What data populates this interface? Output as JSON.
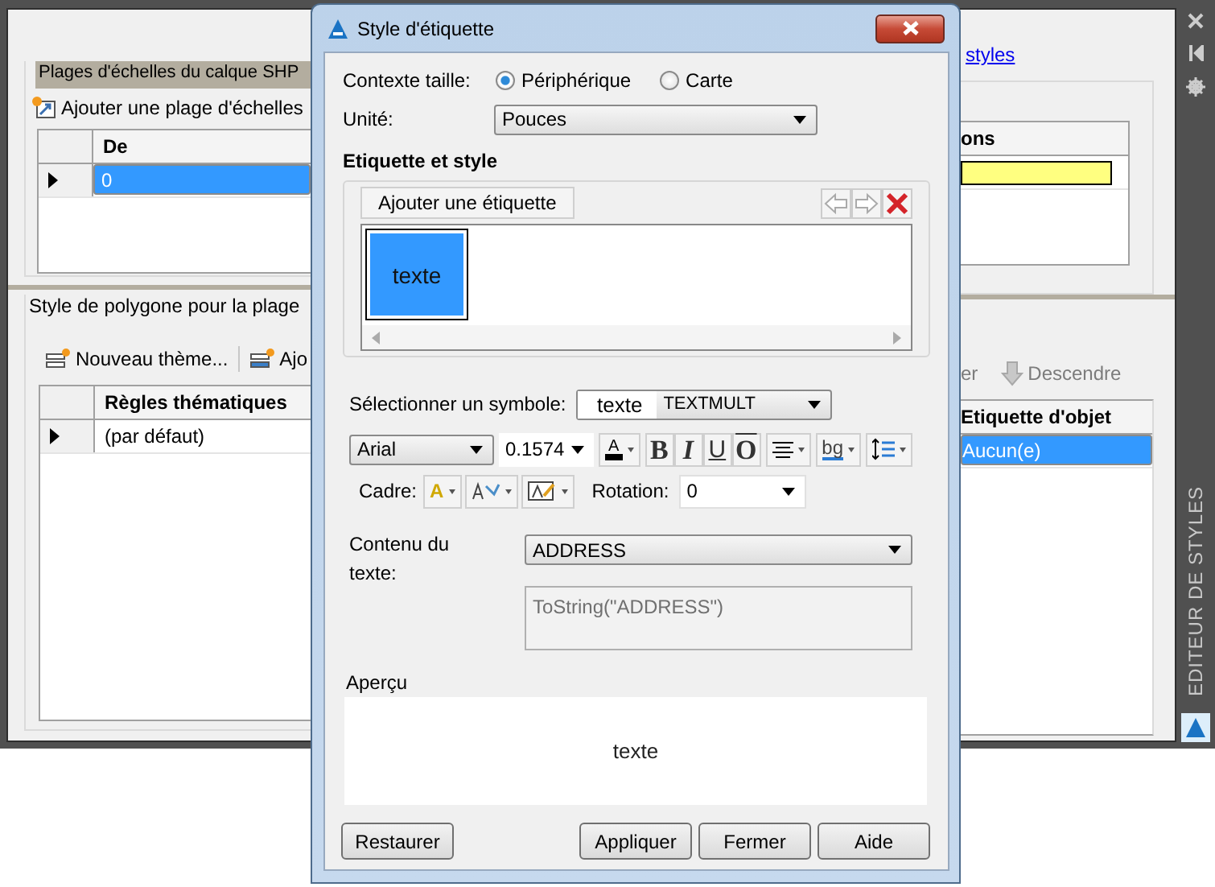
{
  "panel": {
    "scale_group": {
      "title": "Plages d'échelles du calque SHP",
      "add_button": "Ajouter une plage d'échelles",
      "left_column": "De",
      "rows": [
        {
          "value": "0",
          "selected": true
        }
      ]
    },
    "styles_link": "styles",
    "right_column": "ons",
    "right_rows": [
      {
        "color": "#ffff80"
      }
    ],
    "polygon_group": {
      "title": "Style de polygone pour la plage",
      "tools": [
        {
          "label": "Nouveau thème...",
          "disabled": false
        },
        {
          "label": "Ajo",
          "disabled": false
        }
      ],
      "right_tools": [
        {
          "label": "er",
          "disabled": true
        },
        {
          "label": "Descendre",
          "disabled": true
        }
      ],
      "left_column": "Règles thématiques",
      "right_column": "Etiquette d'objet",
      "rows": [
        {
          "rule": "(par défaut)",
          "label": "Aucun(e)",
          "selected": true
        }
      ]
    }
  },
  "side_strip": {
    "title": "EDITEUR DE STYLES"
  },
  "dialog": {
    "title": "Style d'étiquette",
    "size_context": {
      "label": "Contexte taille:",
      "options": [
        {
          "label": "Périphérique",
          "selected": true
        },
        {
          "label": "Carte",
          "selected": false
        }
      ]
    },
    "unit": {
      "label": "Unité:",
      "value": "Pouces"
    },
    "label_section": {
      "title": "Etiquette et style",
      "add_button": "Ajouter une étiquette",
      "labels": [
        {
          "text": "texte",
          "selected": true
        }
      ]
    },
    "symbol": {
      "label": "Sélectionner un symbole:",
      "preview": "texte",
      "value": "TEXTMULT"
    },
    "format": {
      "font": "Arial",
      "size": "0.1574",
      "color_button": "A",
      "style_buttons": [
        {
          "label": "B",
          "on": false
        },
        {
          "label": "I",
          "on": false
        },
        {
          "label": "U",
          "on": false
        },
        {
          "label": "O",
          "on": false
        }
      ],
      "bg_button": "bg"
    },
    "frame": {
      "label": "Cadre:",
      "first_button": "A"
    },
    "rotation": {
      "label": "Rotation:",
      "value": "0"
    },
    "content": {
      "label": "Contenu du texte:",
      "value": "ADDRESS",
      "expression": "ToString(\"ADDRESS\")"
    },
    "preview": {
      "label": "Aperçu",
      "text": "texte"
    },
    "buttons": {
      "left": [
        "Restaurer"
      ],
      "right": [
        "Appliquer",
        "Fermer",
        "Aide"
      ]
    }
  }
}
